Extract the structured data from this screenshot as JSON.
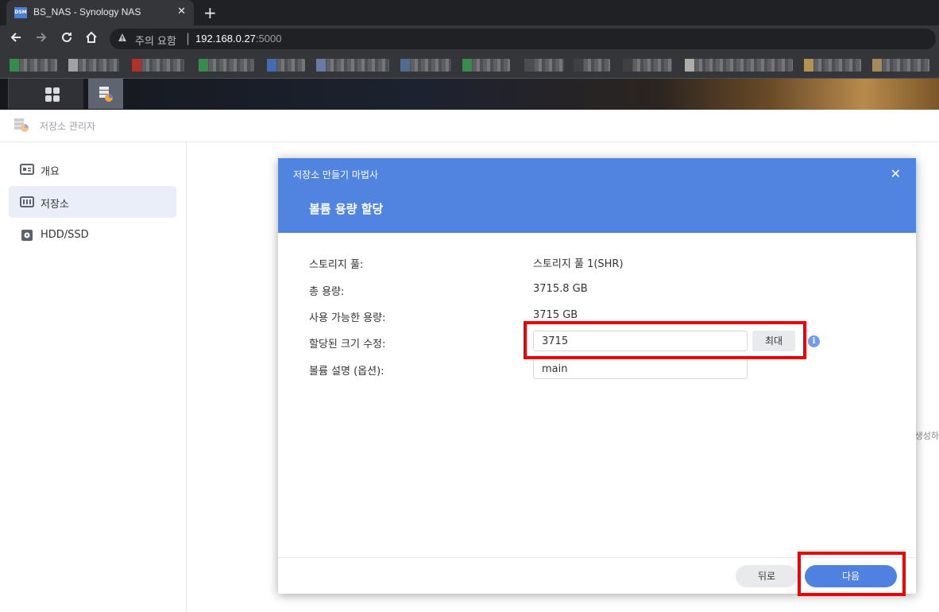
{
  "browser": {
    "tab_title": "BS_NAS - Synology NAS",
    "favicon_text": "DSM",
    "close_glyph": "✕",
    "new_tab_glyph": "+",
    "warning_text": "주의 요함",
    "url_host": "192.168.0.27",
    "url_port": ":5000"
  },
  "app": {
    "title": "저장소 관리자"
  },
  "sidebar": {
    "items": [
      {
        "label": "개요",
        "icon": "overview-icon"
      },
      {
        "label": "저장소",
        "icon": "storage-icon"
      },
      {
        "label": "HDD/SSD",
        "icon": "disk-icon"
      }
    ]
  },
  "background_text": "생성하",
  "dialog": {
    "wizard_title": "저장소 만들기 마법사",
    "close_glyph": "✕",
    "step_title": "볼륨 용량 할당",
    "rows": {
      "pool_label": "스토리지 풀:",
      "pool_value": "스토리지 풀 1(SHR)",
      "total_label": "총 용량:",
      "total_value": "3715.8 GB",
      "available_label": "사용 가능한 용량:",
      "available_value": "3715 GB",
      "size_label": "할당된 크기 수정:",
      "size_value": "3715",
      "max_button": "최대",
      "desc_label": "볼륨 설명 (옵션):",
      "desc_value": "main"
    },
    "info_glyph": "i",
    "back_button": "뒤로",
    "next_button": "다음"
  },
  "colors": {
    "accent": "#5184e0",
    "highlight": "#ee0000"
  }
}
